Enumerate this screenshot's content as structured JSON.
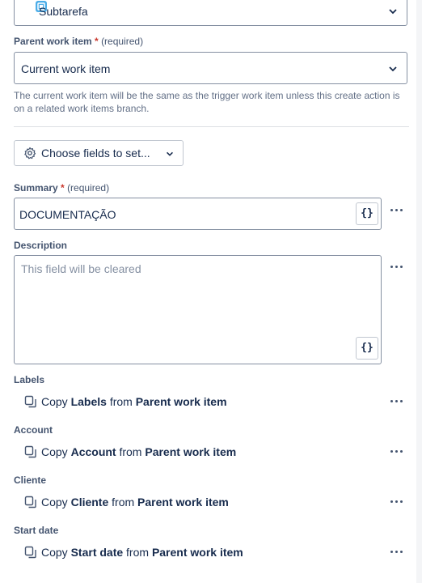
{
  "issue_type": {
    "value": "Subtarefa"
  },
  "parent": {
    "label": "Parent work item",
    "required_mark": "*",
    "required_text": "(required)",
    "value": "Current work item",
    "help": "The current work item will be the same as the trigger work item unless this create action is on a related work items branch."
  },
  "fields_button": {
    "label": "Choose fields to set..."
  },
  "summary": {
    "label": "Summary",
    "required_mark": "*",
    "required_text": "(required)",
    "value": "DOCUMENTAÇÃO",
    "smart_value": "{}"
  },
  "description": {
    "label": "Description",
    "placeholder": "This field will be cleared",
    "smart_value": "{}"
  },
  "copy_fields": [
    {
      "label": "Labels",
      "copy": "Copy",
      "field": "Labels",
      "from": "from",
      "source": "Parent work item"
    },
    {
      "label": "Account",
      "copy": "Copy",
      "field": "Account",
      "from": "from",
      "source": "Parent work item"
    },
    {
      "label": "Cliente",
      "copy": "Copy",
      "field": "Cliente",
      "from": "from",
      "source": "Parent work item"
    },
    {
      "label": "Start date",
      "copy": "Copy",
      "field": "Start date",
      "from": "from",
      "source": "Parent work item"
    }
  ]
}
